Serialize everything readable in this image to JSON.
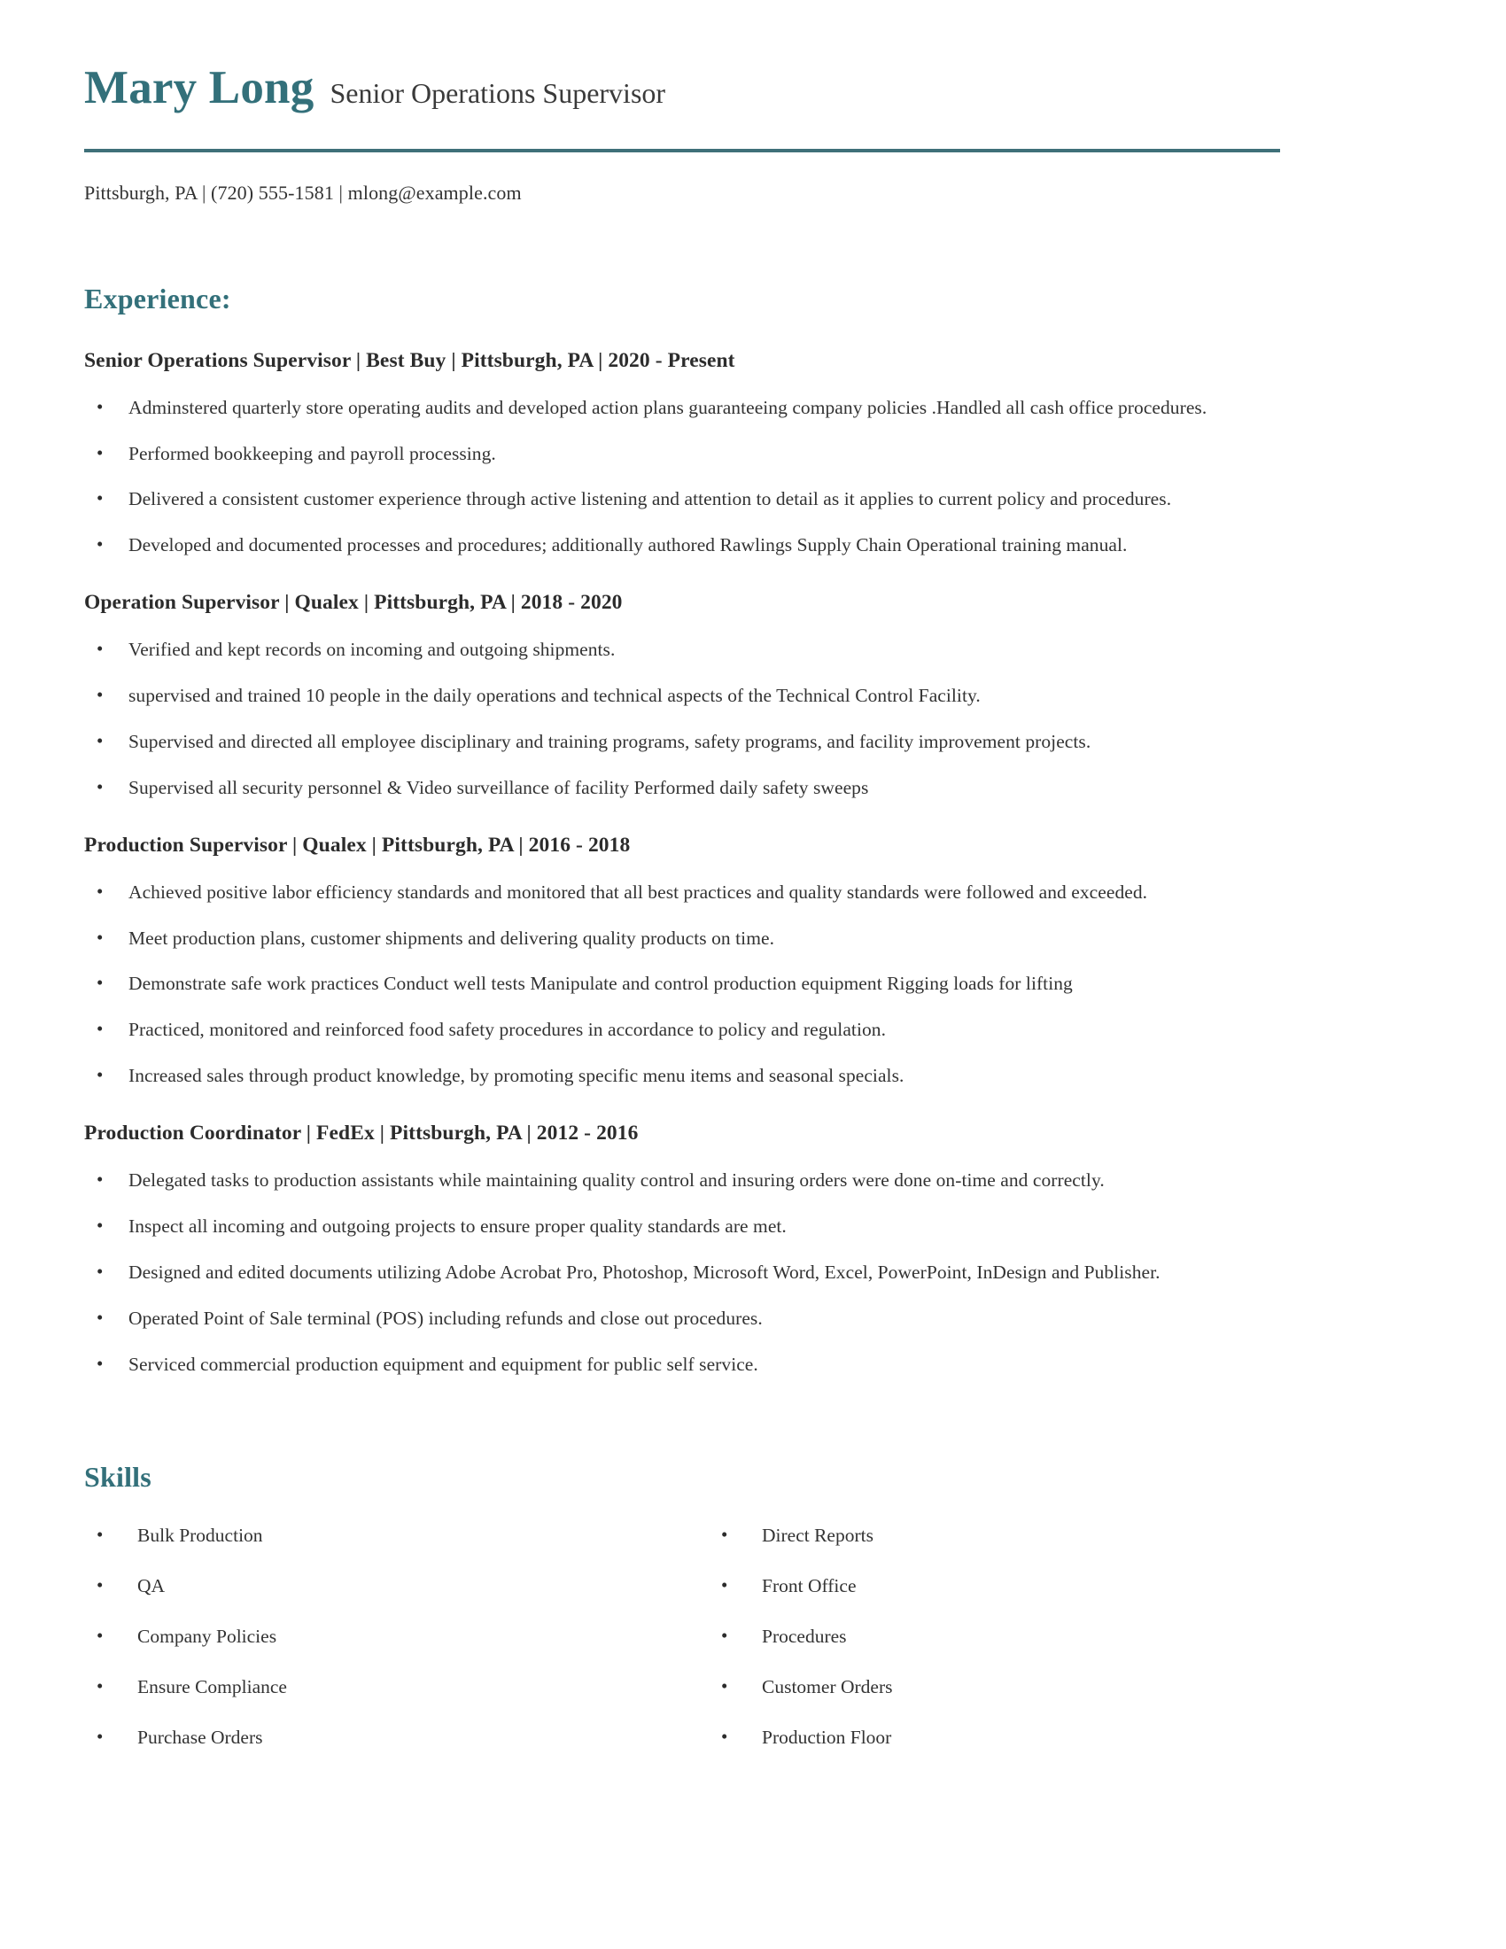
{
  "colors": {
    "accent": "#33707A",
    "rule": "#3F7079",
    "text": "#333333",
    "heading_text": "#2c2c2c",
    "background": "#ffffff"
  },
  "header": {
    "name": "Mary Long",
    "job_title": "Senior Operations Supervisor",
    "contact": "Pittsburgh, PA  |  (720) 555-1581  |  mlong@example.com",
    "location": "Pittsburgh, PA",
    "phone": "(720) 555-1581",
    "email": "mlong@example.com"
  },
  "experience": {
    "heading": "Experience:",
    "jobs": [
      {
        "heading": "Senior Operations Supervisor | Best Buy | Pittsburgh, PA | 2020 - Present",
        "title": "Senior Operations Supervisor",
        "company": "Best Buy",
        "location": "Pittsburgh, PA",
        "dates": "2020 - Present",
        "bullets": [
          "Adminstered quarterly store operating audits and developed action plans guaranteeing company policies .Handled all cash office procedures.",
          "Performed bookkeeping and payroll processing.",
          "Delivered a consistent customer experience through active listening and attention to detail as it applies to current policy and procedures.",
          "Developed and documented processes and procedures; additionally authored Rawlings Supply Chain Operational training manual."
        ]
      },
      {
        "heading": "Operation Supervisor | Qualex | Pittsburgh, PA | 2018 - 2020",
        "title": "Operation Supervisor",
        "company": "Qualex",
        "location": "Pittsburgh, PA",
        "dates": "2018 - 2020",
        "bullets": [
          "Verified and kept records on incoming and outgoing shipments.",
          "supervised and trained 10 people in the daily operations and technical aspects of the Technical Control Facility.",
          "Supervised and directed all employee disciplinary and training programs, safety programs, and facility improvement projects.",
          "Supervised all security personnel & Video surveillance of facility Performed daily safety sweeps"
        ]
      },
      {
        "heading": "Production Supervisor | Qualex | Pittsburgh, PA | 2016 - 2018",
        "title": "Production Supervisor",
        "company": "Qualex",
        "location": "Pittsburgh, PA",
        "dates": "2016 - 2018",
        "bullets": [
          "Achieved positive labor efficiency standards and monitored that all best practices and quality standards were followed and exceeded.",
          "Meet production plans, customer shipments and delivering quality products on time.",
          "Demonstrate safe work practices Conduct well tests Manipulate and control production equipment Rigging loads for lifting",
          "Practiced, monitored and reinforced food safety procedures in accordance to policy and regulation.",
          "Increased sales through product knowledge, by promoting specific menu items and seasonal specials."
        ]
      },
      {
        "heading": "Production Coordinator | FedEx | Pittsburgh, PA | 2012 - 2016",
        "title": "Production Coordinator",
        "company": "FedEx",
        "location": "Pittsburgh, PA",
        "dates": "2012 - 2016",
        "bullets": [
          "Delegated tasks to production assistants while maintaining quality control and insuring orders were done on-time and correctly.",
          "Inspect all incoming and outgoing projects to ensure proper quality standards are met.",
          "Designed and edited documents utilizing Adobe Acrobat Pro, Photoshop, Microsoft Word, Excel, PowerPoint, InDesign and Publisher.",
          "Operated Point of Sale terminal (POS) including refunds and close out procedures.",
          "Serviced commercial production equipment and equipment for public self service."
        ]
      }
    ]
  },
  "skills": {
    "heading": "Skills",
    "column_left": [
      "Bulk Production",
      "QA",
      "Company Policies",
      "Ensure Compliance",
      "Purchase Orders"
    ],
    "column_right": [
      "Direct Reports",
      "Front Office",
      "Procedures",
      "Customer Orders",
      "Production Floor"
    ]
  }
}
